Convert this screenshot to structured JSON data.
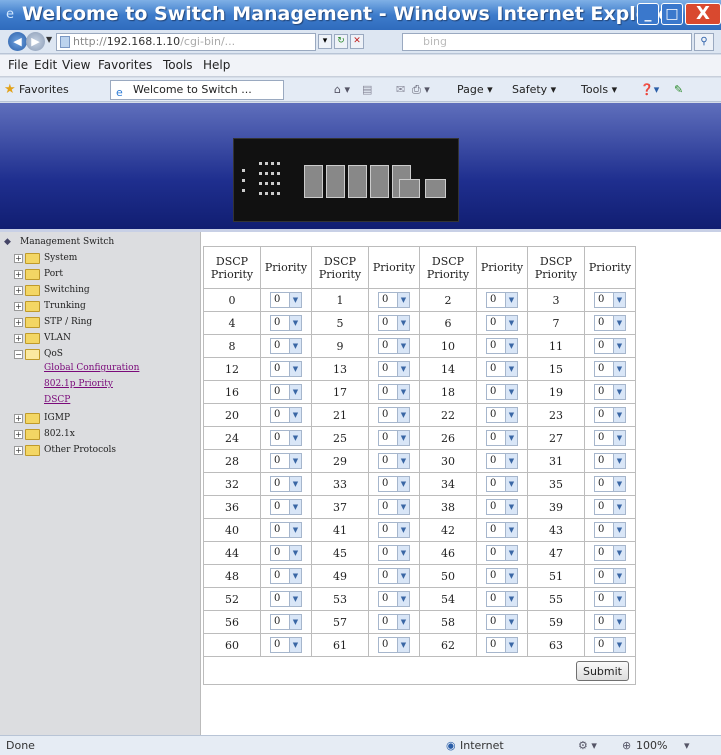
{
  "window": {
    "title": "Welcome to Switch Management - Windows Internet Explorer",
    "min_label": "_",
    "max_label": "□",
    "close_label": "X"
  },
  "address": {
    "url_prefix": "http://",
    "url_host": "192.168.1.10",
    "url_path": "/cgi-bin/...",
    "search_placeholder": "bing"
  },
  "menu": [
    "File",
    "Edit",
    "View",
    "Favorites",
    "Tools",
    "Help"
  ],
  "favorites": {
    "label": "Favorites",
    "tab_title": "Welcome to Switch ...",
    "commands": [
      "Page ▾",
      "Safety ▾",
      "Tools ▾"
    ]
  },
  "sidebar": {
    "root": "Management Switch",
    "items": [
      "System",
      "Port",
      "Switching",
      "Trunking",
      "STP / Ring",
      "VLAN",
      "QoS",
      "IGMP",
      "802.1x",
      "Other Protocols"
    ],
    "qos_children": [
      "Global Configuration",
      "802.1p Priority",
      "DSCP"
    ]
  },
  "table": {
    "header_dscp": "DSCP Priority",
    "header_priority": "Priority",
    "rows": [
      [
        0,
        1,
        2,
        3
      ],
      [
        4,
        5,
        6,
        7
      ],
      [
        8,
        9,
        10,
        11
      ],
      [
        12,
        13,
        14,
        15
      ],
      [
        16,
        17,
        18,
        19
      ],
      [
        20,
        21,
        22,
        23
      ],
      [
        24,
        25,
        26,
        27
      ],
      [
        28,
        29,
        30,
        31
      ],
      [
        32,
        33,
        34,
        35
      ],
      [
        36,
        37,
        38,
        39
      ],
      [
        40,
        41,
        42,
        43
      ],
      [
        44,
        45,
        46,
        47
      ],
      [
        48,
        49,
        50,
        51
      ],
      [
        52,
        53,
        54,
        55
      ],
      [
        56,
        57,
        58,
        59
      ],
      [
        60,
        61,
        62,
        63
      ]
    ],
    "priority_value": "0",
    "submit_label": "Submit"
  },
  "status": {
    "left": "Done",
    "zone": "Internet",
    "zoom": "100%"
  },
  "colors": {
    "titlebar": "#3e7ccb",
    "banner": "#1f2f8f",
    "sidebar_bg": "#dcdde0",
    "link_visited": "#7a0a7a"
  }
}
